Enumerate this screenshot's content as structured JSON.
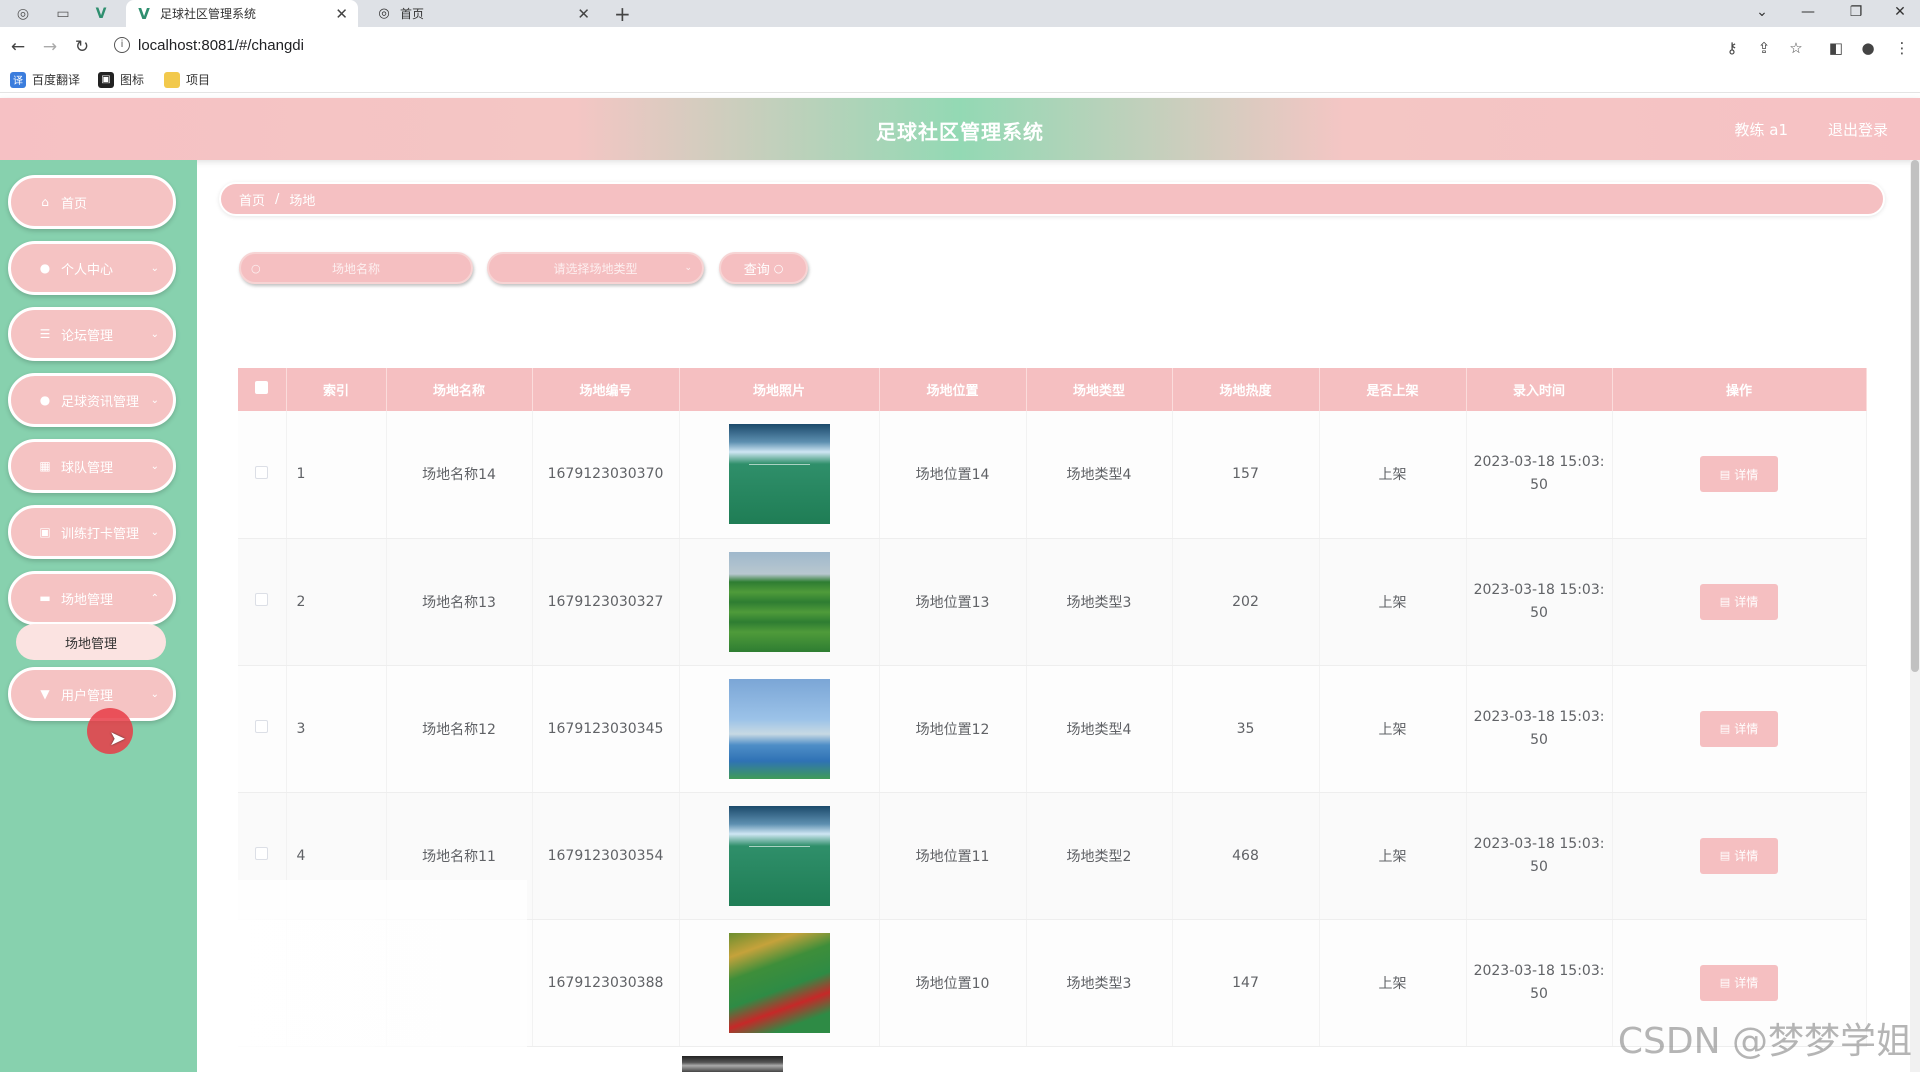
{
  "browser": {
    "tabs": [
      {
        "title": "足球社区管理系统",
        "active": true
      },
      {
        "title": "首页",
        "active": false
      }
    ],
    "url": "localhost:8081/#/changdi",
    "bookmarks": [
      "百度翻译",
      "图标",
      "项目"
    ]
  },
  "header": {
    "title": "足球社区管理系统",
    "user": "教练 a1",
    "logout": "退出登录"
  },
  "sidebar": {
    "items": [
      {
        "label": "首页",
        "icon": "home-icon"
      },
      {
        "label": "个人中心",
        "icon": "user-icon"
      },
      {
        "label": "论坛管理",
        "icon": "list-icon"
      },
      {
        "label": "足球资讯管理",
        "icon": "user-icon"
      },
      {
        "label": "球队管理",
        "icon": "grid-icon"
      },
      {
        "label": "训练打卡管理",
        "icon": "check-icon"
      },
      {
        "label": "场地管理",
        "icon": "monitor-icon"
      },
      {
        "label": "用户管理",
        "icon": "cup-icon"
      }
    ],
    "submenu_label": "场地管理"
  },
  "breadcrumb": [
    "首页",
    "场地"
  ],
  "search": {
    "name_placeholder": "场地名称",
    "type_placeholder": "请选择场地类型",
    "query_label": "查询"
  },
  "table": {
    "headers": [
      "索引",
      "场地名称",
      "场地编号",
      "场地照片",
      "场地位置",
      "场地类型",
      "场地热度",
      "是否上架",
      "录入时间",
      "操作"
    ],
    "rows": [
      {
        "index": "1",
        "name": "场地名称14",
        "code": "1679123030370",
        "location": "场地位置14",
        "type": "场地类型4",
        "heat": "157",
        "status": "上架",
        "time_1": "2023-03-18 15:03:",
        "time_2": "50"
      },
      {
        "index": "2",
        "name": "场地名称13",
        "code": "1679123030327",
        "location": "场地位置13",
        "type": "场地类型3",
        "heat": "202",
        "status": "上架",
        "time_1": "2023-03-18 15:03:",
        "time_2": "50"
      },
      {
        "index": "3",
        "name": "场地名称12",
        "code": "1679123030345",
        "location": "场地位置12",
        "type": "场地类型4",
        "heat": "35",
        "status": "上架",
        "time_1": "2023-03-18 15:03:",
        "time_2": "50"
      },
      {
        "index": "4",
        "name": "场地名称11",
        "code": "1679123030354",
        "location": "场地位置11",
        "type": "场地类型2",
        "heat": "468",
        "status": "上架",
        "time_1": "2023-03-18 15:03:",
        "time_2": "50"
      },
      {
        "index": "",
        "name": "",
        "code": "1679123030388",
        "location": "场地位置10",
        "type": "场地类型3",
        "heat": "147",
        "status": "上架",
        "time_1": "2023-03-18 15:03:",
        "time_2": "50"
      }
    ],
    "detail_label": "详情"
  },
  "watermark": "CSDN @梦梦学姐",
  "colors": {
    "accent_pink": "#f5bfc1",
    "sidebar_green": "#87d1ae"
  }
}
